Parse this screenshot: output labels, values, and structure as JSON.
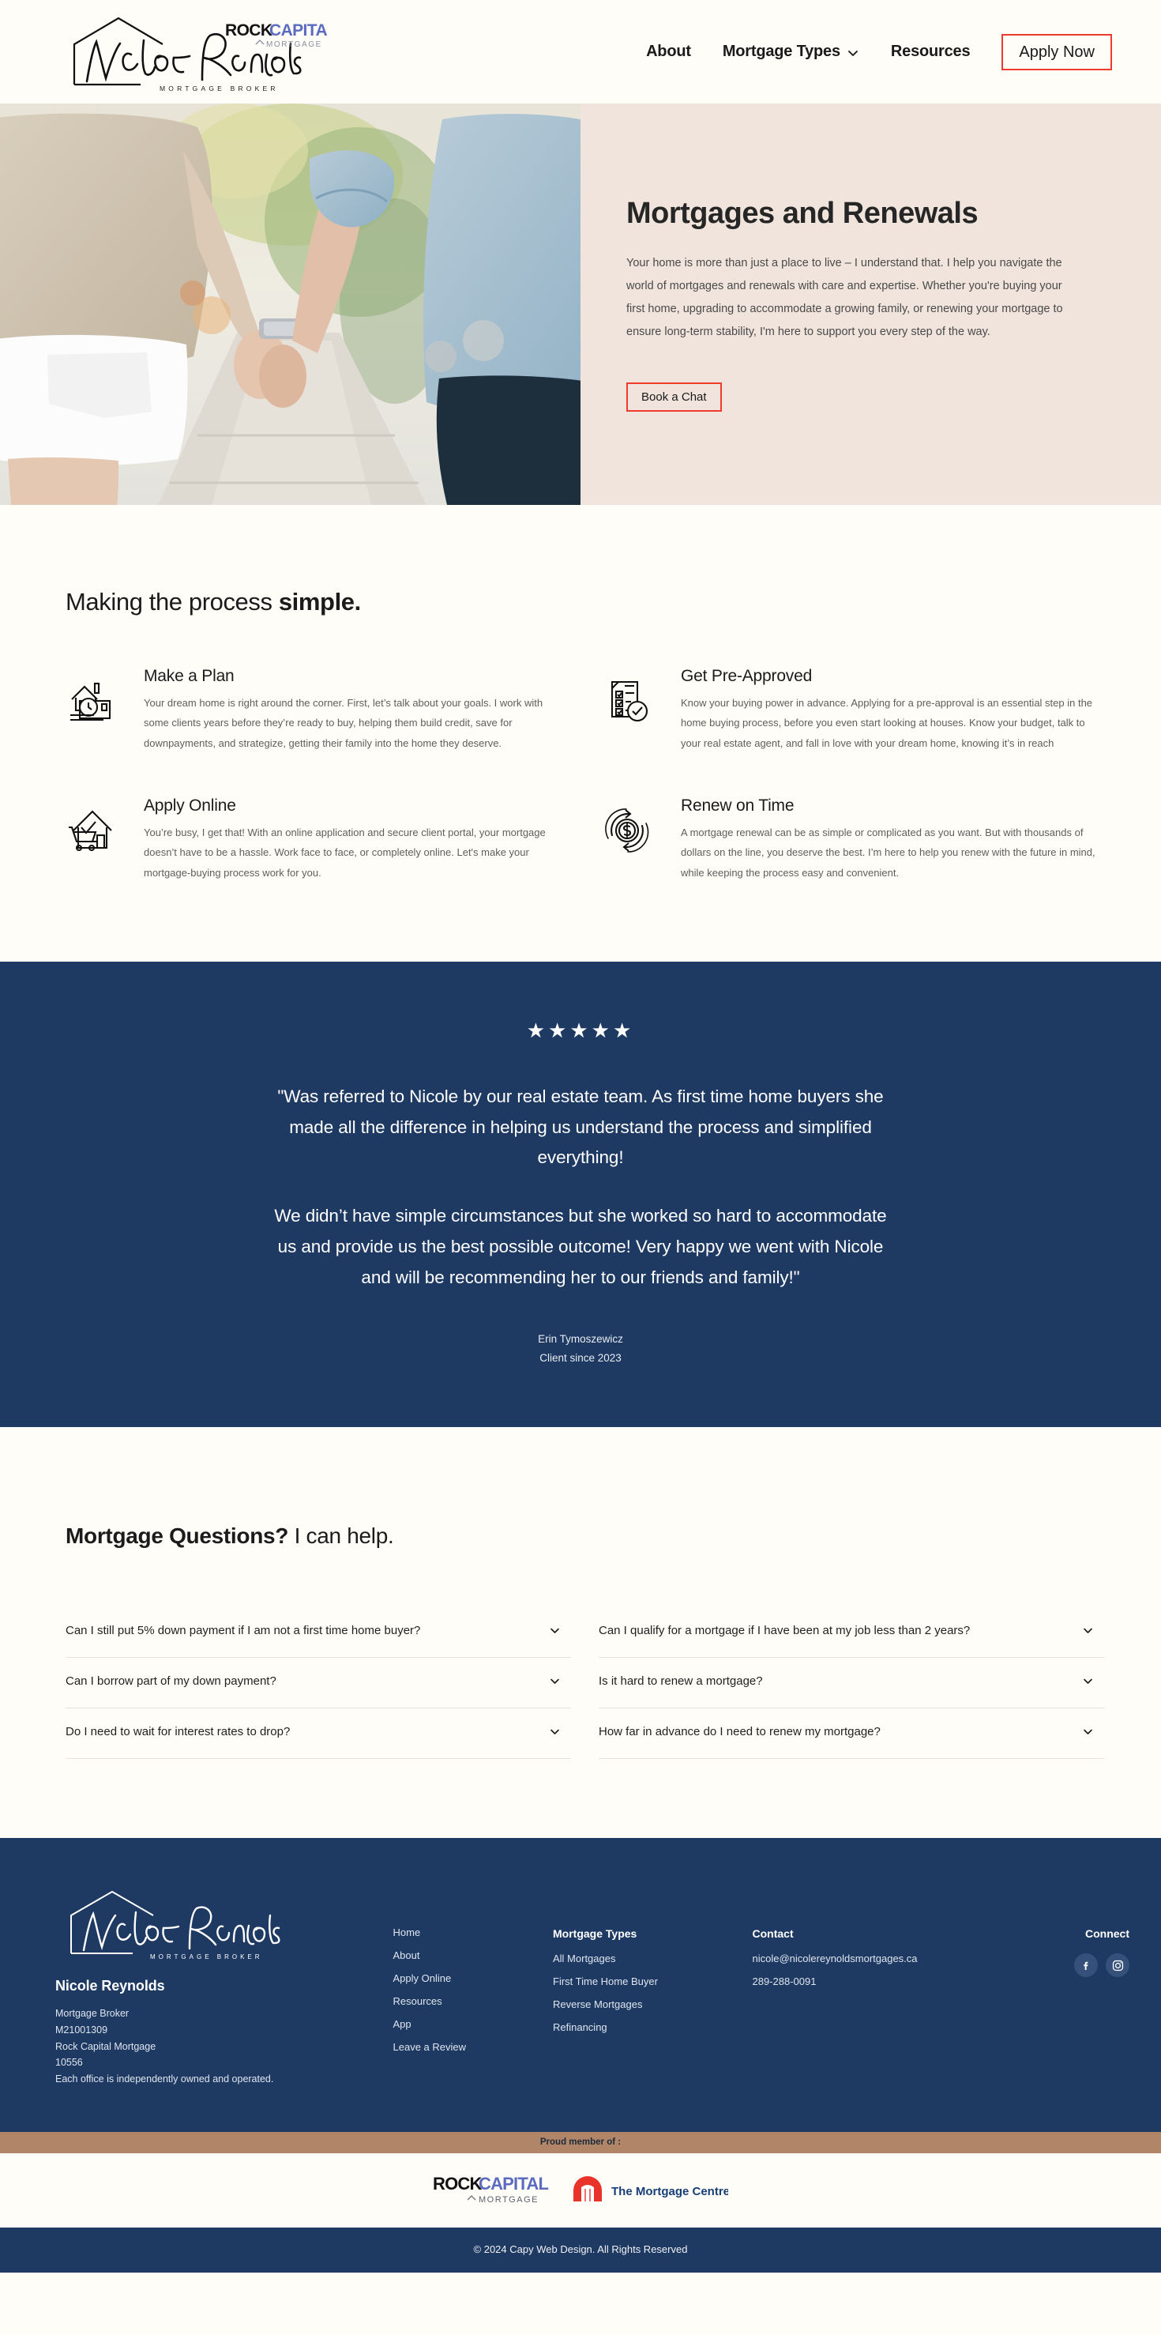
{
  "header": {
    "logo": {
      "signature": "Nicole Reynolds",
      "tagline": "M O R T G A G E   B R O K E R",
      "partner_rock": "ROCK",
      "partner_capital": "CAPITAL",
      "partner_mortgage": "MORTGAGE"
    },
    "nav": [
      {
        "label": "About",
        "has_dropdown": false
      },
      {
        "label": "Mortgage Types",
        "has_dropdown": true
      },
      {
        "label": "Resources",
        "has_dropdown": false
      }
    ],
    "cta": {
      "label": "Apply Now",
      "border_color": "#ef3b2d"
    }
  },
  "hero": {
    "title": "Mortgages and Renewals",
    "body": "Your home is more than just a place to live – I understand that. I help you navigate the world of mortgages and renewals with care and expertise. Whether you're buying your first home, upgrading to accommodate a growing family, or renewing your mortgage to ensure long-term stability, I'm here to support you every step of the way.",
    "cta": {
      "label": "Book a Chat",
      "border_color": "#ef3b2d"
    },
    "bg_color": "#f0e4dc",
    "image_alt": "Couple holding hands walking on a sidewalk"
  },
  "process": {
    "title_light": "Making the process ",
    "title_bold": "simple.",
    "features": [
      {
        "icon": "house-clock-icon",
        "heading": "Make a Plan",
        "body": "Your dream home is right around the corner. First, let’s talk about your goals. I work with some clients years before they’re ready to buy, helping them build credit, save for downpayments, and strategize, getting their family into the home they deserve."
      },
      {
        "icon": "checklist-approved-icon",
        "heading": "Get Pre-Approved",
        "body": "Know your buying power in advance. Applying for a pre-approval is an essential step in the home buying process, before you even start looking at houses. Know your budget, talk to your real estate agent, and fall in love with your dream home, knowing it’s in reach"
      },
      {
        "icon": "house-cart-icon",
        "heading": "Apply Online",
        "body": "You’re busy, I get that! With an online application and secure client portal, your mortgage doesn’t have to be a hassle. Work face to face, or completely online. Let's make your mortgage-buying process work for you."
      },
      {
        "icon": "renew-dollar-icon",
        "heading": "Renew on Time",
        "body": "A mortgage renewal can be as simple or complicated as you want. But with thousands of dollars on the line, you deserve the best. I’m here to help you renew with the future in mind, while keeping the process easy and convenient."
      }
    ]
  },
  "testimonial": {
    "rating": 5,
    "stars": "★★★★★",
    "paragraphs": [
      "\"Was referred to Nicole by our real estate team. As first time home buyers she made all the difference in helping us understand the process and simplified everything!",
      "We didn’t have simple circumstances but she worked so hard to accommodate us and provide us the best possible outcome! Very happy we went with Nicole and will be recommending her to our friends and family!\""
    ],
    "author": "Erin Tymoszewicz",
    "author_meta": "Client since 2023",
    "bg_color": "#1e3a63"
  },
  "faq": {
    "title_bold": "Mortgage Questions?",
    "title_light": " I can help.",
    "left_column": [
      "Can I still put 5% down payment if I am not a first time home buyer?",
      "Can I borrow part of my down payment?",
      "Do I need to wait for interest rates to drop?"
    ],
    "right_column": [
      "Can I qualify for a mortgage if I have been at my job less than 2 years?",
      "Is it hard to renew a mortgage?",
      "How far in advance do I need to renew my mortgage?"
    ]
  },
  "footer": {
    "brand": {
      "signature": "Nicole Reynolds",
      "tagline": "M O R T G A G E   B R O K E R",
      "name": "Nicole Reynolds",
      "address_lines": [
        "Mortgage Broker",
        "M21001309",
        "Rock Capital Mortgage",
        "10556",
        "Each office is independently owned and operated."
      ]
    },
    "links_column": [
      "Home",
      "About",
      "Apply Online",
      "Resources",
      "App",
      "Leave a Review"
    ],
    "mortgage_types": {
      "heading": "Mortgage Types",
      "items": [
        "All Mortgages",
        "First Time Home Buyer",
        "Reverse Mortgages",
        "Refinancing"
      ]
    },
    "contact": {
      "heading": "Contact",
      "email": "nicole@nicolereynoldsmortgages.ca",
      "phone": "289-288-0091"
    },
    "connect": {
      "heading": "Connect",
      "socials": [
        {
          "name": "facebook-icon",
          "label": "f"
        },
        {
          "name": "instagram-icon",
          "label": "ig"
        }
      ]
    },
    "bg_color": "#1e3a63"
  },
  "proud": {
    "label": "Proud member of :",
    "bg_color": "#b08568",
    "partners": [
      {
        "name": "rock-capital-mortgage-logo",
        "line1a": "ROCK",
        "line1b": "CAPITAL",
        "line2": "MORTGAGE"
      },
      {
        "name": "the-mortgage-centre-logo",
        "label": "The Mortgage Centre"
      }
    ]
  },
  "copyright": {
    "text": "© 2024 Capy Web Design. All Rights Reserved"
  }
}
